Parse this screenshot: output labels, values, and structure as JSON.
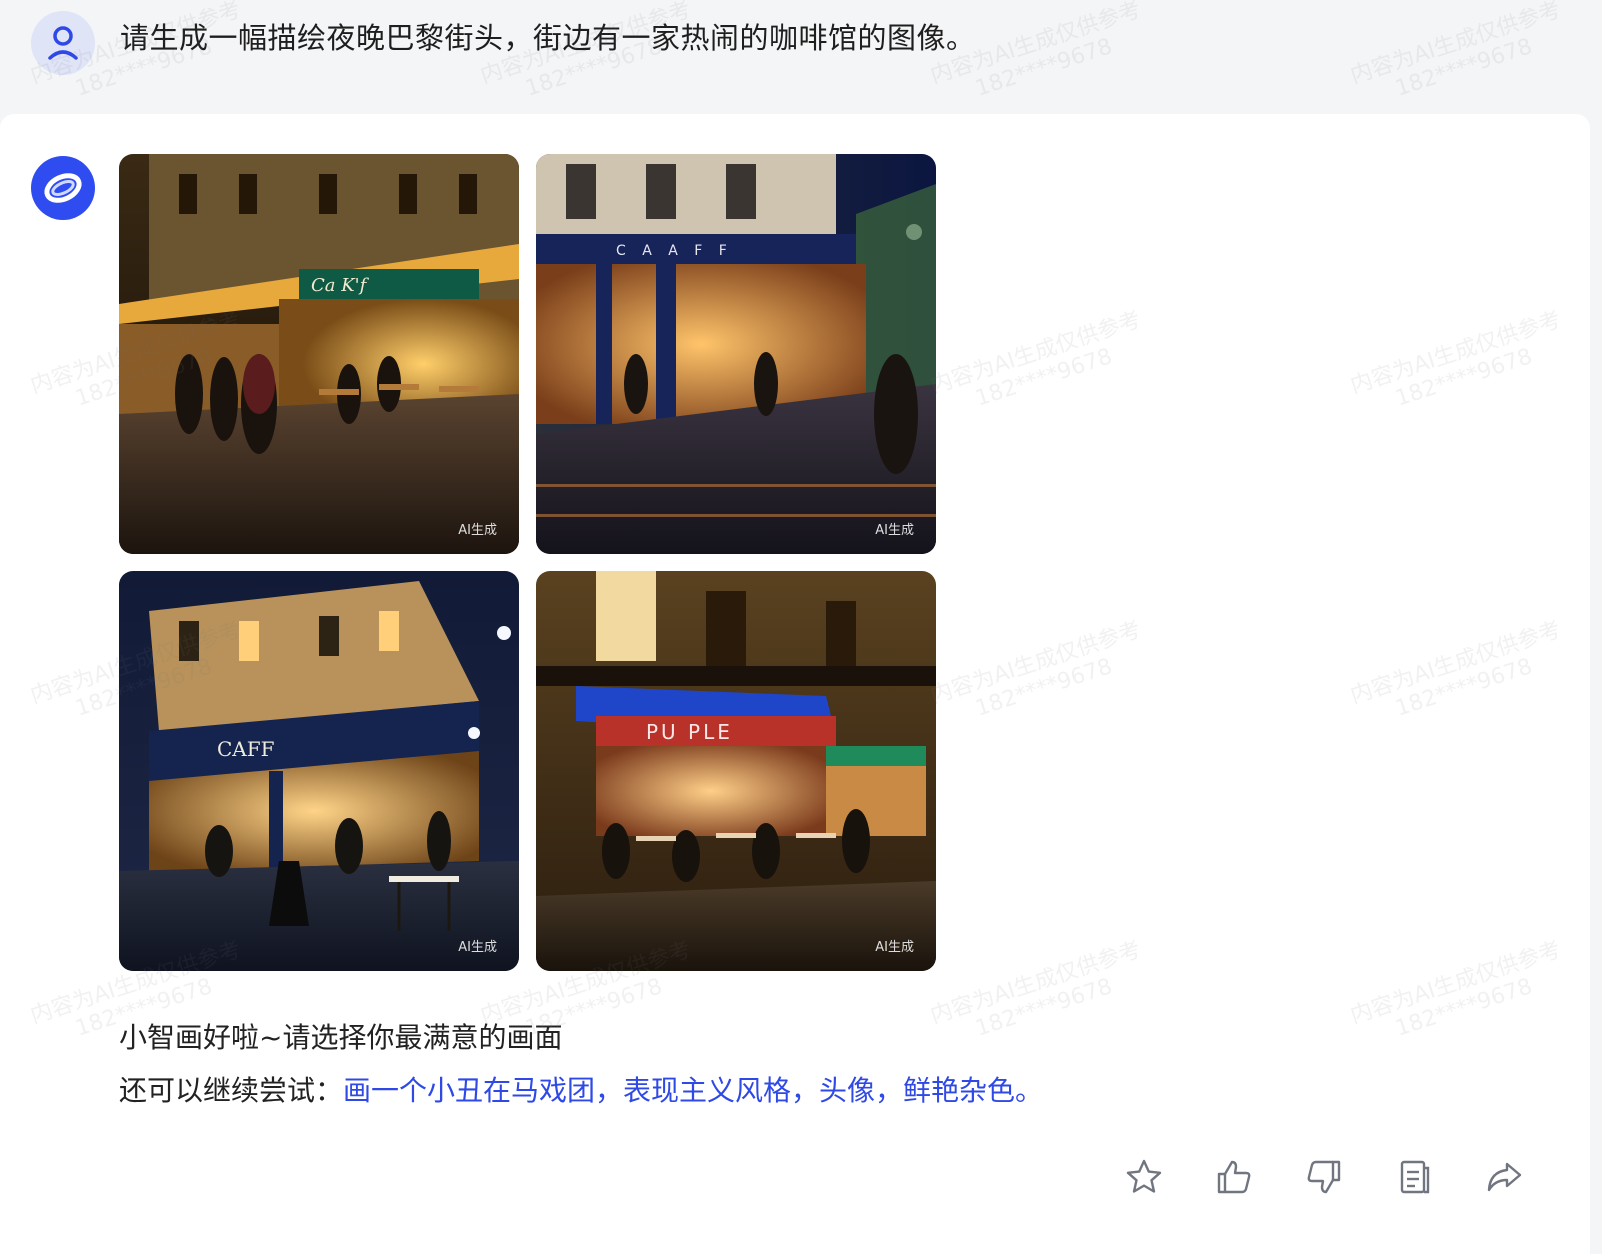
{
  "user_message": {
    "avatar_icon": "user-icon",
    "text": "请生成一幅描绘夜晚巴黎街头，街边有一家热闹的咖啡馆的图像。"
  },
  "assistant": {
    "avatar_icon": "assistant-logo-icon",
    "images": [
      {
        "tag": "AI生成",
        "signage": "Ca K'f"
      },
      {
        "tag": "AI生成",
        "signage": "C A A F F"
      },
      {
        "tag": "AI生成",
        "signage": "CAFF"
      },
      {
        "tag": "AI生成",
        "signage": "PU PLE"
      }
    ],
    "reply_line1": "小智画好啦~请选择你最满意的画面",
    "reply_prefix": "还可以继续尝试：",
    "suggestion": "画一个小丑在马戏团，表现主义风格，头像，鲜艳杂色。"
  },
  "actions": [
    {
      "icon": "star-icon"
    },
    {
      "icon": "thumbs-up-icon"
    },
    {
      "icon": "thumbs-down-icon"
    },
    {
      "icon": "copy-icon"
    },
    {
      "icon": "share-icon"
    }
  ],
  "watermark": {
    "line1": "内容为AI生成仅供参考",
    "line2": "182****9678"
  },
  "colors": {
    "page_bg": "#f4f5f7",
    "card_bg": "#ffffff",
    "link": "#2f49e6",
    "brand": "#2e4cf0"
  }
}
